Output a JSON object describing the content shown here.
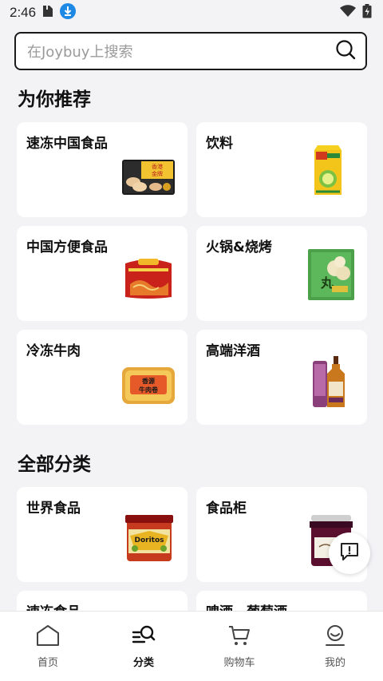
{
  "status_bar": {
    "time": "2:46"
  },
  "search": {
    "placeholder": "在Joybuy上搜索"
  },
  "recommend": {
    "title": "为你推荐",
    "items": [
      {
        "label": "速冻中国食品",
        "icon": "frozen-dumplings-image"
      },
      {
        "label": "饮料",
        "icon": "lemon-tea-image"
      },
      {
        "label": "中国方便食品",
        "icon": "instant-noodles-image"
      },
      {
        "label": "火锅&烧烤",
        "icon": "fish-balls-image"
      },
      {
        "label": "冷冻牛肉",
        "icon": "beef-roll-image"
      },
      {
        "label": "高端洋酒",
        "icon": "whisky-image"
      }
    ]
  },
  "all_categories": {
    "title": "全部分类",
    "items": [
      {
        "label": "世界食品",
        "icon": "salsa-jar-image"
      },
      {
        "label": "食品柜",
        "icon": "jam-jar-image"
      },
      {
        "label": "速冻食品"
      },
      {
        "label": "啤酒、葡萄酒"
      }
    ]
  },
  "bottom_nav": {
    "items": [
      {
        "label": "首页",
        "icon": "home-icon"
      },
      {
        "label": "分类",
        "icon": "category-search-icon",
        "active": true
      },
      {
        "label": "购物车",
        "icon": "cart-icon"
      },
      {
        "label": "我的",
        "icon": "profile-icon"
      }
    ]
  },
  "colors": {
    "accent_download": "#1e88e5",
    "background": "#f3f3f6"
  }
}
